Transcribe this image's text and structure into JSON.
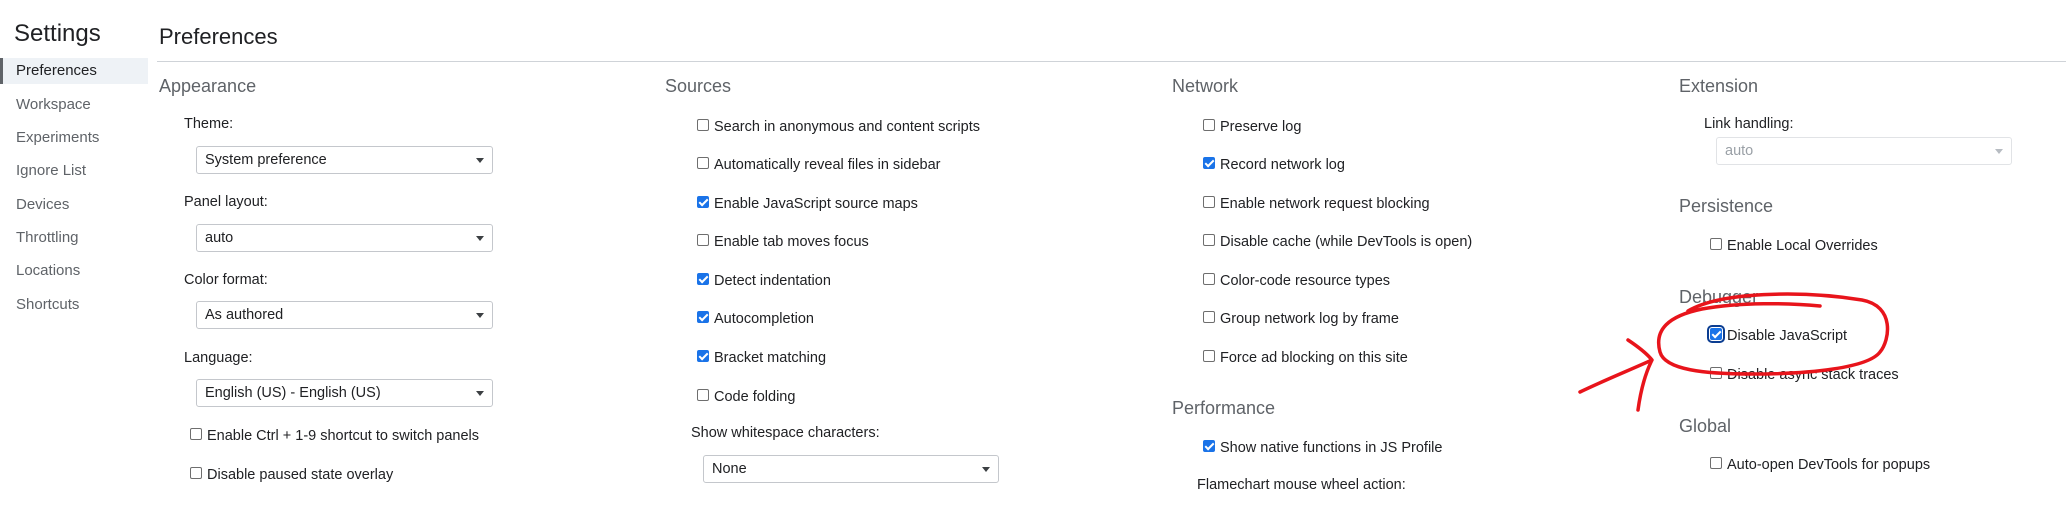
{
  "sidebar": {
    "title": "Settings",
    "items": [
      {
        "label": "Preferences",
        "active": true
      },
      {
        "label": "Workspace"
      },
      {
        "label": "Experiments"
      },
      {
        "label": "Ignore List"
      },
      {
        "label": "Devices"
      },
      {
        "label": "Throttling"
      },
      {
        "label": "Locations"
      },
      {
        "label": "Shortcuts"
      }
    ]
  },
  "header": {
    "title": "Preferences"
  },
  "appearance": {
    "title": "Appearance",
    "theme_label": "Theme:",
    "theme_value": "System preference",
    "panel_layout_label": "Panel layout:",
    "panel_layout_value": "auto",
    "color_format_label": "Color format:",
    "color_format_value": "As authored",
    "language_label": "Language:",
    "language_value": "English (US) - English (US)",
    "checkboxes": [
      {
        "label": "Enable Ctrl + 1-9 shortcut to switch panels",
        "checked": false
      },
      {
        "label": "Disable paused state overlay",
        "checked": false
      }
    ]
  },
  "sources": {
    "title": "Sources",
    "checkboxes": [
      {
        "label": "Search in anonymous and content scripts",
        "checked": false
      },
      {
        "label": "Automatically reveal files in sidebar",
        "checked": false
      },
      {
        "label": "Enable JavaScript source maps",
        "checked": true
      },
      {
        "label": "Enable tab moves focus",
        "checked": false
      },
      {
        "label": "Detect indentation",
        "checked": true
      },
      {
        "label": "Autocompletion",
        "checked": true
      },
      {
        "label": "Bracket matching",
        "checked": true
      },
      {
        "label": "Code folding",
        "checked": false
      }
    ],
    "whitespace_label": "Show whitespace characters:",
    "whitespace_value": "None"
  },
  "network": {
    "title": "Network",
    "checkboxes": [
      {
        "label": "Preserve log",
        "checked": false
      },
      {
        "label": "Record network log",
        "checked": true
      },
      {
        "label": "Enable network request blocking",
        "checked": false
      },
      {
        "label": "Disable cache (while DevTools is open)",
        "checked": false
      },
      {
        "label": "Color-code resource types",
        "checked": false
      },
      {
        "label": "Group network log by frame",
        "checked": false
      },
      {
        "label": "Force ad blocking on this site",
        "checked": false
      }
    ]
  },
  "performance": {
    "title": "Performance",
    "checkboxes": [
      {
        "label": "Show native functions in JS Profile",
        "checked": true
      }
    ],
    "flamechart_label": "Flamechart mouse wheel action:"
  },
  "extension": {
    "title": "Extension",
    "link_handling_label": "Link handling:",
    "link_handling_value": "auto"
  },
  "persistence": {
    "title": "Persistence",
    "checkboxes": [
      {
        "label": "Enable Local Overrides",
        "checked": false
      }
    ]
  },
  "debugger": {
    "title": "Debugger",
    "checkboxes": [
      {
        "label": "Disable JavaScript",
        "checked": true
      },
      {
        "label": "Disable async stack traces",
        "checked": false
      }
    ]
  },
  "global": {
    "title": "Global",
    "checkboxes": [
      {
        "label": "Auto-open DevTools for popups",
        "checked": false
      }
    ]
  },
  "colors": {
    "accent": "#1a73e8",
    "annotation": "#e8141b"
  }
}
